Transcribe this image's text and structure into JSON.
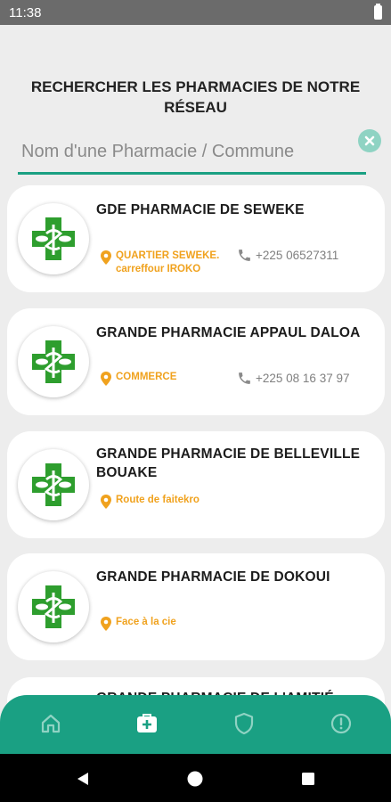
{
  "status_bar": {
    "time": "11:38"
  },
  "header": {
    "title": "RECHERCHER LES PHARMACIES DE NOTRE RÉSEAU"
  },
  "search": {
    "placeholder": "Nom d'une Pharmacie / Commune",
    "value": ""
  },
  "pharmacies": [
    {
      "name": "GDE PHARMACIE DE SEWEKE",
      "address": "QUARTIER SEWEKE. carreffour IROKO",
      "phone": "+225 06527311"
    },
    {
      "name": "GRANDE PHARMACIE APPAUL DALOA",
      "address": "COMMERCE",
      "phone": "+225 08 16 37 97"
    },
    {
      "name": "GRANDE PHARMACIE DE BELLEVILLE BOUAKE",
      "address": "Route de faitekro",
      "phone": ""
    },
    {
      "name": "GRANDE PHARMACIE DE DOKOUI",
      "address": "Face à la cie",
      "phone": ""
    },
    {
      "name": "GRANDE PHARMACIE DE L'AMITIÉ",
      "address": "",
      "phone": ""
    }
  ],
  "bottom_nav": {
    "items": [
      {
        "icon": "home-icon",
        "active": false
      },
      {
        "icon": "medical-kit-icon",
        "active": true
      },
      {
        "icon": "shield-icon",
        "active": false
      },
      {
        "icon": "alert-icon",
        "active": false
      }
    ]
  },
  "colors": {
    "accent": "#1aa083",
    "cross_green": "#2e9e2e",
    "address_orange": "#f0a21e"
  }
}
